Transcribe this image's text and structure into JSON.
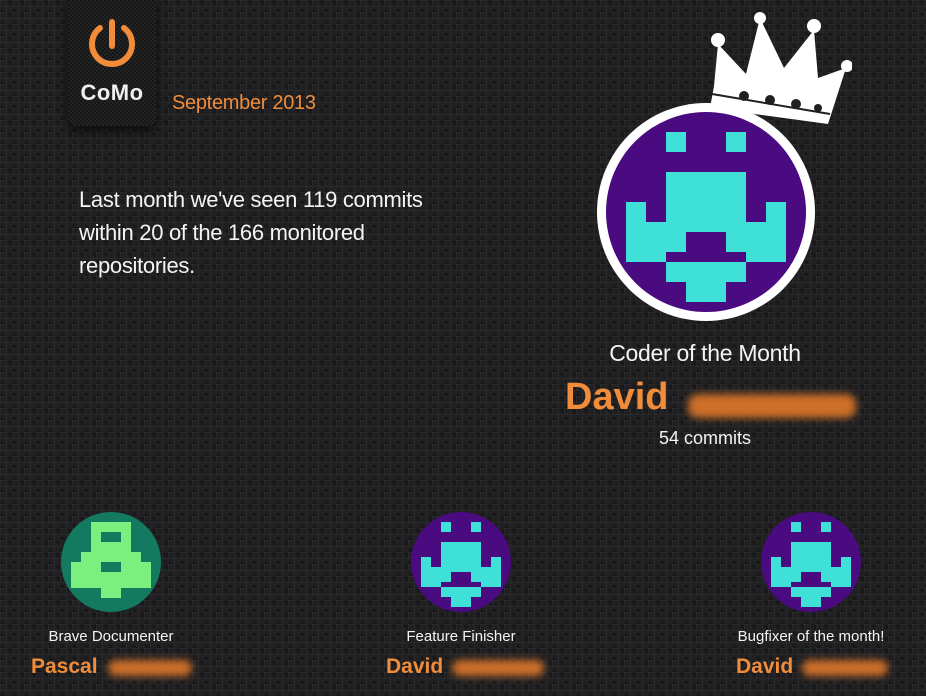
{
  "brand": {
    "logo_text": "CoMo",
    "accent_color": "#f08c3a"
  },
  "header": {
    "month": "September 2013"
  },
  "summary": {
    "line1": "Last month we've seen 119 commits",
    "line2": "within 20 of the 166 monitored",
    "line3": "repositories."
  },
  "coder_of_month": {
    "title": "Coder of the Month",
    "first_name": "David",
    "commits": "54 commits",
    "avatar_color": "#4a0a80",
    "icon_color": "#3ee0d8"
  },
  "awards": [
    {
      "title": "Brave Documenter",
      "first_name": "Pascal",
      "avatar": "green-pixel-avatar"
    },
    {
      "title": "Feature Finisher",
      "first_name": "David",
      "avatar": "purple-pixel-avatar"
    },
    {
      "title": "Bugfixer of the month!",
      "first_name": "David",
      "avatar": "purple-pixel-avatar"
    }
  ]
}
